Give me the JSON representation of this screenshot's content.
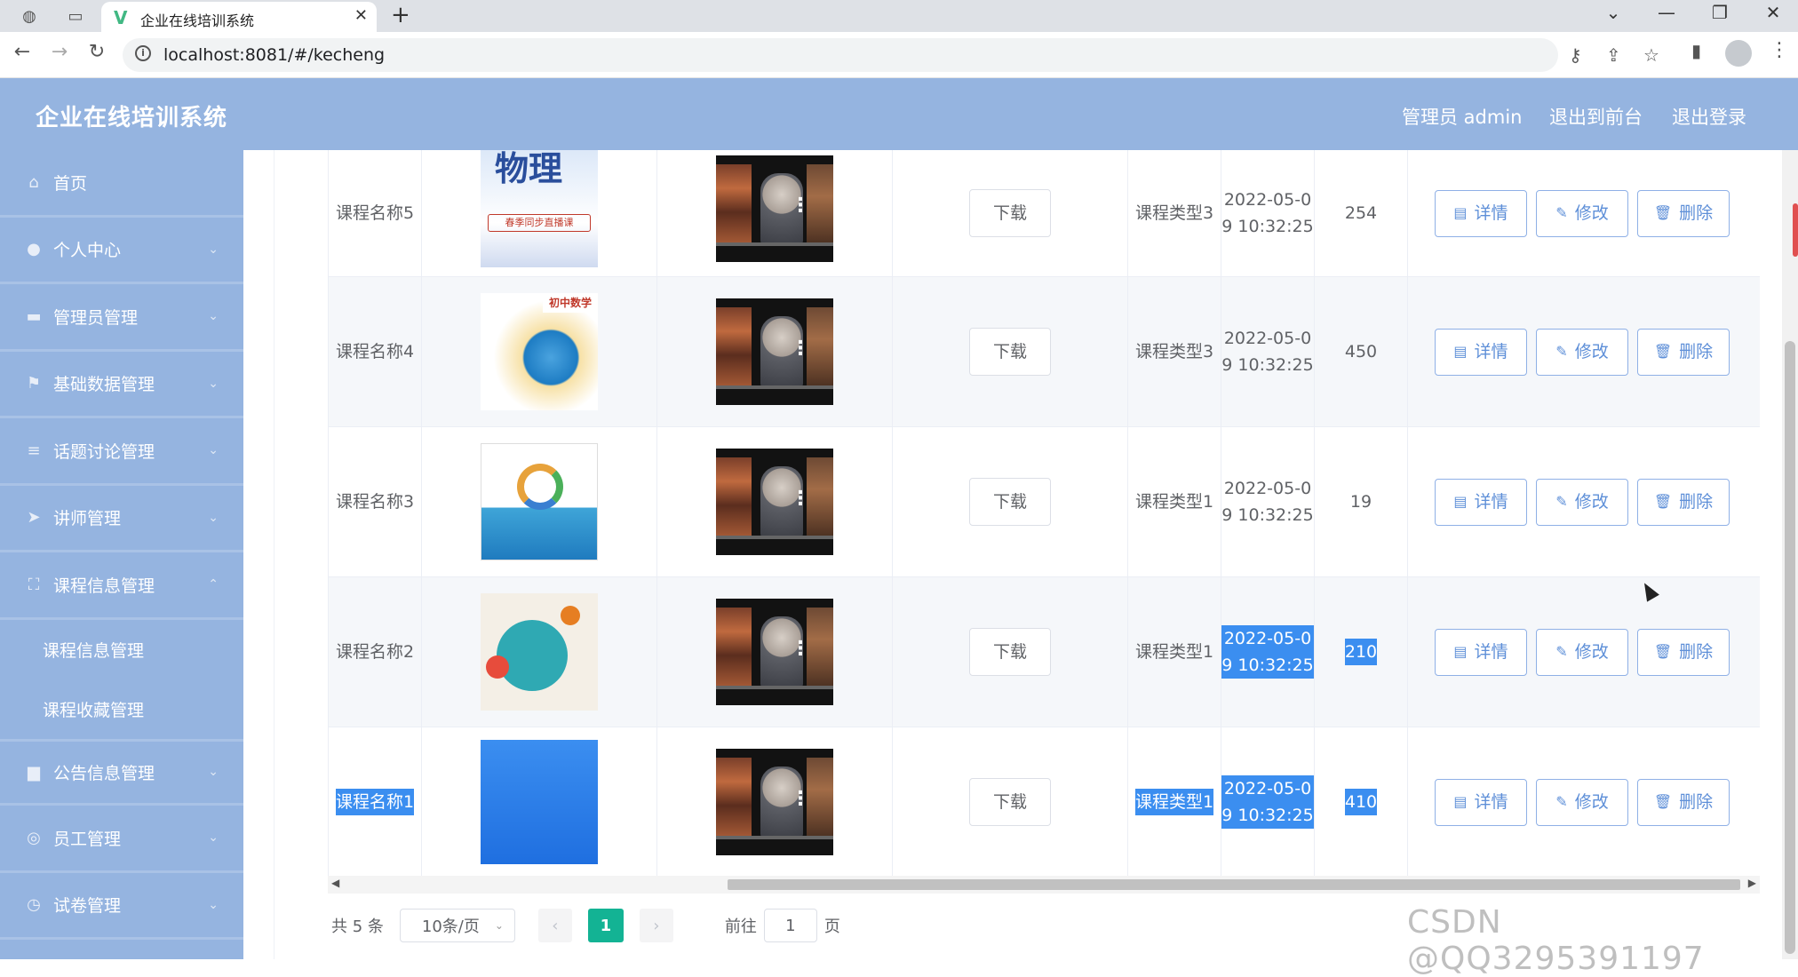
{
  "browser": {
    "tab_title": "企业在线培训系统",
    "tab_logo": "V",
    "url": "localhost:8081/#/kecheng"
  },
  "header": {
    "title": "企业在线培训系统",
    "user_label": "管理员 admin",
    "to_front": "退出到前台",
    "logout": "退出登录"
  },
  "sidebar": {
    "items": [
      {
        "label": "首页",
        "icon": "home-icon"
      },
      {
        "label": "个人中心",
        "icon": "user-icon"
      },
      {
        "label": "管理员管理",
        "icon": "briefcase-icon"
      },
      {
        "label": "基础数据管理",
        "icon": "flag-icon"
      },
      {
        "label": "话题讨论管理",
        "icon": "sliders-icon"
      },
      {
        "label": "讲师管理",
        "icon": "send-icon"
      },
      {
        "label": "课程信息管理",
        "icon": "fullscreen-icon"
      }
    ],
    "subitems": [
      "课程信息管理",
      "课程收藏管理"
    ],
    "items_after": [
      {
        "label": "公告信息管理",
        "icon": "monitor-icon"
      },
      {
        "label": "员工管理",
        "icon": "globe-icon"
      },
      {
        "label": "试卷管理",
        "icon": "compass-icon"
      }
    ]
  },
  "table": {
    "download_label": "下载",
    "ops": {
      "detail": "详情",
      "edit": "修改",
      "delete": "删除"
    },
    "rows": [
      {
        "name": "课程名称5",
        "cover": "physics",
        "cover_text": "物理",
        "cover_sub": "春季同步直播课",
        "type": "课程类型3",
        "time": "2022-05-09 10:32:25",
        "count": "254"
      },
      {
        "name": "课程名称4",
        "cover": "math",
        "cover_text": "初中数学",
        "type": "课程类型3",
        "time": "2022-05-09 10:32:25",
        "count": "450"
      },
      {
        "name": "课程名称3",
        "cover": "java",
        "type": "课程类型1",
        "time": "2022-05-09 10:32:25",
        "count": "19"
      },
      {
        "name": "课程名称2",
        "cover": "desk",
        "type": "课程类型1",
        "time": "2022-05-09 10:32:25",
        "count": "210"
      },
      {
        "name": "课程名称1",
        "cover": "blue",
        "type": "课程类型1",
        "time": "2022-05-09 10:32:25",
        "count": "410"
      }
    ]
  },
  "pagination": {
    "total": "共 5 条",
    "page_size": "10条/页",
    "current": "1",
    "goto_prefix": "前往",
    "goto_value": "1",
    "goto_suffix": "页"
  },
  "watermark": "CSDN @QQ3295391197"
}
